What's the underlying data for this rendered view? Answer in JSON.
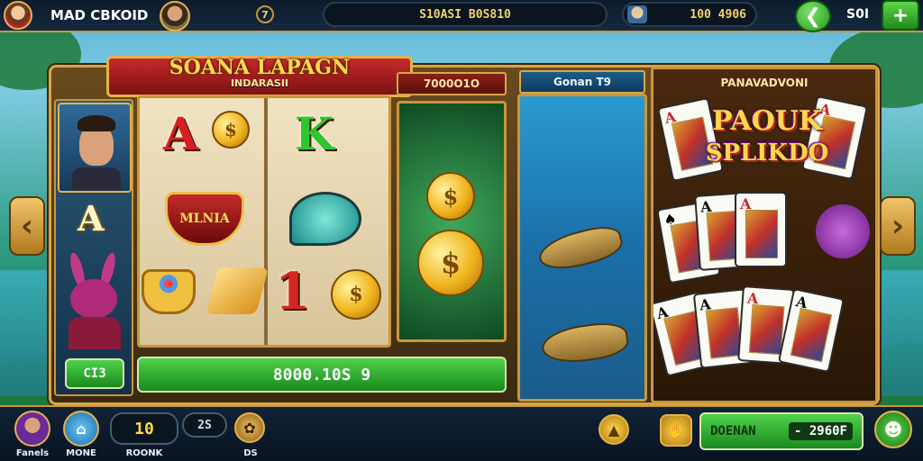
{
  "top_bar": {
    "player_name": "MAD CBKOID",
    "level_badge": "7",
    "jackpot_amount": "S10ASI B0S810",
    "coin_balance": "100 4906",
    "right_label": "S0I"
  },
  "game": {
    "title": "SOANA LAPAGN",
    "subtitle": "INDARASII",
    "reels_header": "7000O1O",
    "left_symbol": "A",
    "left_spin_button": "CI3",
    "win_amount": "8000.10S 9",
    "reel_symbols": [
      "A",
      "K",
      "MLNIA",
      "1"
    ]
  },
  "fishing": {
    "header": "Gonan T9"
  },
  "poker": {
    "header": "PANAVADVONI",
    "title_line1": "PAOUK",
    "title_line2": "SPLIKDO"
  },
  "bottom_bar": {
    "nav_items": [
      {
        "label": "Fanels"
      },
      {
        "label": "MONE"
      }
    ],
    "bet_value": "10",
    "bet_label": "ROONK",
    "lines_value": "2S",
    "extra_label": "DS",
    "collect_label": "DOENAN",
    "collect_amount": "- 2960F"
  },
  "colors": {
    "accent_gold": "#d8a648",
    "ribbon_red": "#b3261e",
    "button_green": "#2aa623"
  },
  "icons": [
    "back-arrow-icon",
    "add-icon",
    "chevron-left-icon",
    "chevron-right-icon",
    "bell-icon",
    "thumbs-up-icon",
    "gift-icon",
    "home-icon"
  ]
}
